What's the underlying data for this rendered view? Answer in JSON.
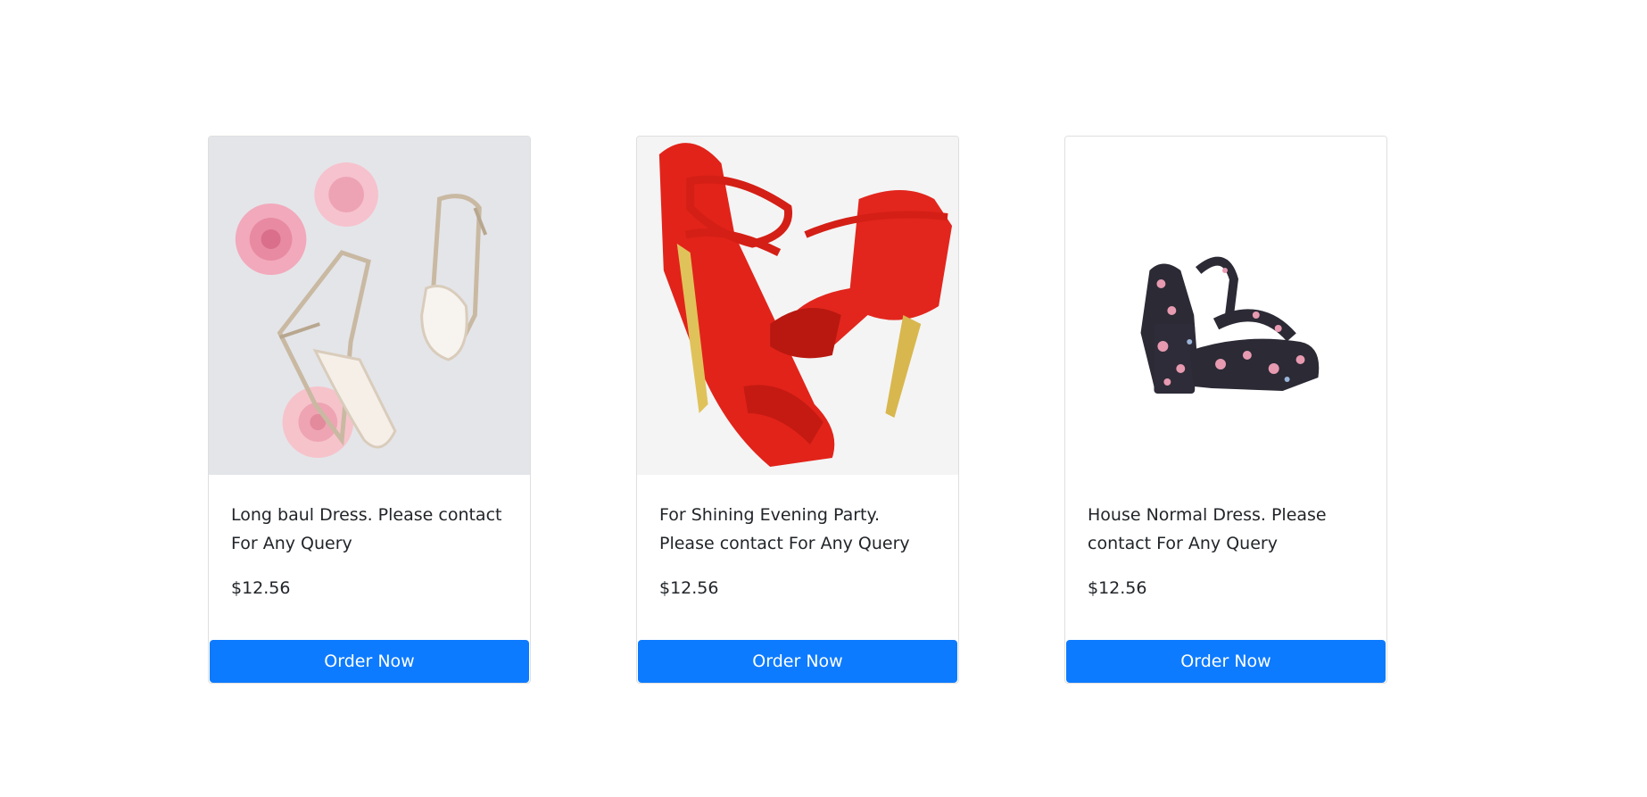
{
  "products": [
    {
      "description": "Long baul Dress. Please contact For Any Query",
      "price": "$12.56",
      "button_label": "Order Now",
      "image": "white-strappy-heels-with-pink-roses"
    },
    {
      "description": "For Shining Evening Party. Please contact For Any Query",
      "price": "$12.56",
      "button_label": "Order Now",
      "image": "red-ankle-strap-heels"
    },
    {
      "description": "House Normal Dress. Please contact For Any Query",
      "price": "$12.56",
      "button_label": "Order Now",
      "image": "floral-block-heel-sandal"
    }
  ],
  "colors": {
    "button": "#0d7bff",
    "border": "#dfdfdf"
  }
}
